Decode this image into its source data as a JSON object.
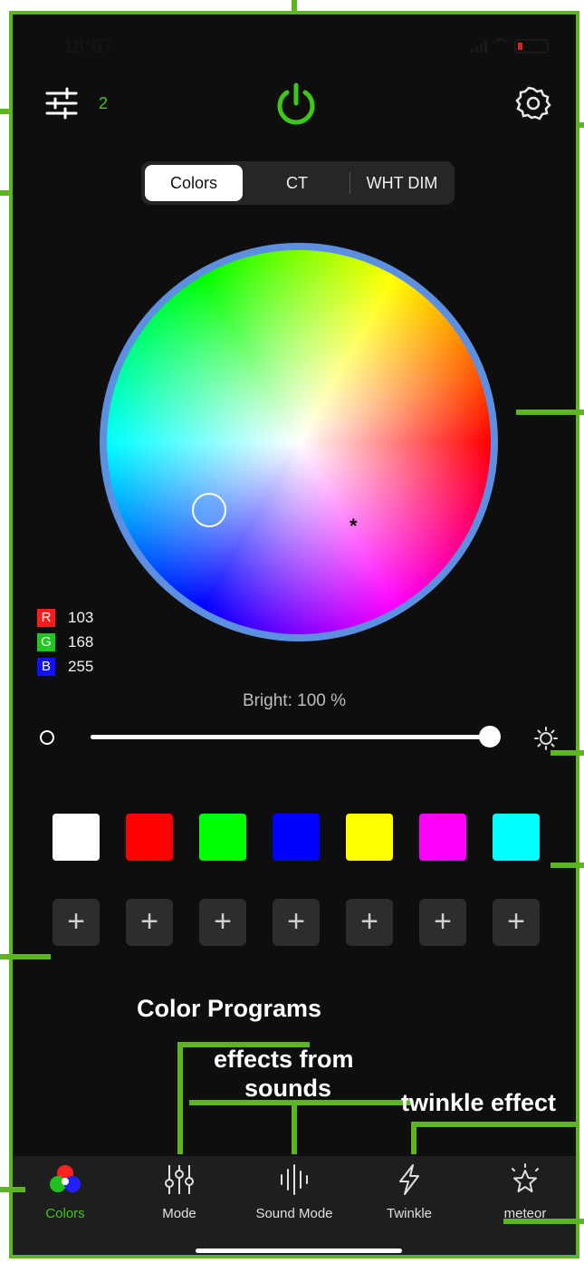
{
  "status": {
    "time": "18:07"
  },
  "header": {
    "filter_count": "2"
  },
  "tabs": [
    {
      "label": "Colors",
      "active": true
    },
    {
      "label": "CT",
      "active": false
    },
    {
      "label": "WHT DIM",
      "active": false
    }
  ],
  "rgb": [
    {
      "tag": "R",
      "value": "103",
      "color": "#ff1a1a"
    },
    {
      "tag": "G",
      "value": "168",
      "color": "#1ec81e"
    },
    {
      "tag": "B",
      "value": "255",
      "color": "#1010ff"
    }
  ],
  "brightness": {
    "label": "Bright:  100 %",
    "value_percent": 100
  },
  "swatches": [
    "#ffffff",
    "#ff0000",
    "#00ff00",
    "#0000ff",
    "#ffff00",
    "#ff00ff",
    "#00ffff"
  ],
  "add_button_symbol": "+",
  "annotations": {
    "color_programs": "Color Programs",
    "effects_line1": "effects from",
    "effects_line2": "sounds",
    "twinkle": "twinkle effect"
  },
  "nav": [
    {
      "label": "Colors",
      "icon": "rgb-circles-icon",
      "active": true
    },
    {
      "label": "Mode",
      "icon": "sliders-icon",
      "active": false
    },
    {
      "label": "Sound Mode",
      "icon": "sound-wave-icon",
      "active": false
    },
    {
      "label": "Twinkle",
      "icon": "lightning-icon",
      "active": false
    },
    {
      "label": "meteor",
      "icon": "star-burst-icon",
      "active": false
    }
  ],
  "colors": {
    "accent": "#3ec61a",
    "annotation": "#5db522",
    "background": "#0e0e0e"
  }
}
